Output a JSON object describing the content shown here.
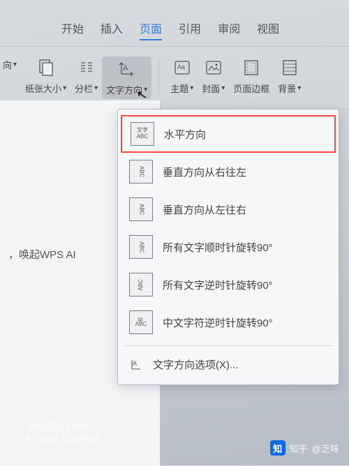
{
  "tabs": {
    "start": "开始",
    "insert": "插入",
    "page": "页面",
    "reference": "引用",
    "review": "审阅",
    "view": "视图"
  },
  "toolbar": {
    "orientation_partial": "向",
    "paper_size": "纸张大小",
    "columns": "分栏",
    "text_direction": "文字方向",
    "theme": "主题",
    "cover": "封面",
    "page_border": "页面边框",
    "background": "背景"
  },
  "dropdown": {
    "horizontal": "水平方向",
    "vertical_rtl": "垂直方向从右往左",
    "vertical_ltr": "垂直方向从左往右",
    "rotate_cw": "所有文字顺时针旋转90°",
    "rotate_ccw": "所有文字逆时针旋转90°",
    "cjk_ccw": "中文字符逆时针旋转90°",
    "options": "文字方向选项(X)...",
    "icon_top": "文字",
    "icon_bot": "ABC"
  },
  "doc": {
    "hint": "，唤起WPS AI"
  },
  "watermark": {
    "brand": "MEIZU 16th",
    "sub": "AI DUAL CAMERA",
    "zhihu": "知乎",
    "author": "@乏味"
  }
}
